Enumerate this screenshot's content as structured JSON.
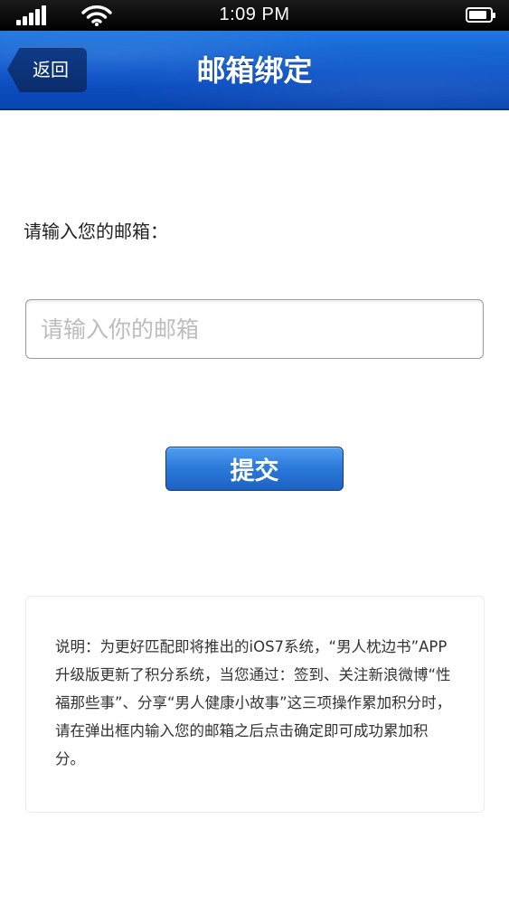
{
  "status_bar": {
    "time": "1:09 PM",
    "battery_level": 0.85,
    "icons": [
      "signal-icon",
      "wifi-icon",
      "battery-icon"
    ]
  },
  "header": {
    "back_label": "返回",
    "title": "邮箱绑定"
  },
  "form": {
    "label": "请输入您的邮箱：",
    "email_value": "",
    "email_placeholder": "请输入你的邮箱",
    "submit_label": "提交"
  },
  "note": {
    "text": "说明：为更好匹配即将推出的iOS7系统，“男人枕边书”APP升级版更新了积分系统，当您通过：签到、关注新浪微博“性福那些事”、分享“男人健康小故事”这三项操作累加积分时，请在弹出框内输入您的邮箱之后点击确定即可成功累加积分。"
  },
  "colors": {
    "header_blue": "#0b52c8",
    "button_blue": "#2a78d8",
    "back_button": "#0a2c6b"
  }
}
